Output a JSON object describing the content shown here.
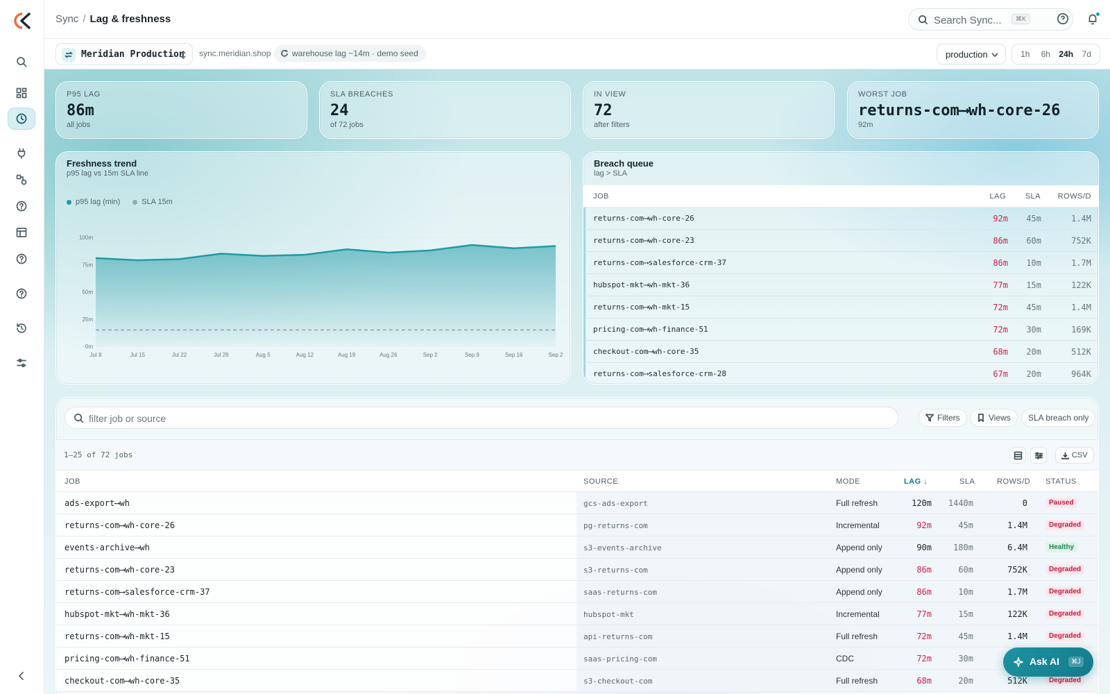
{
  "breadcrumb": {
    "root": "Sync",
    "separator": "/",
    "current": "Lag & freshness"
  },
  "search": {
    "placeholder": "Search Sync...",
    "shortcut": "⌘K"
  },
  "context": {
    "workspace": "Meridian Production",
    "domain": "sync.meridian.shop",
    "lag_note": "warehouse lag ~14m · demo seed",
    "environment": "production",
    "ranges": [
      "1h",
      "6h",
      "24h",
      "7d"
    ],
    "selected_range": "24h"
  },
  "stats": [
    {
      "label": "P95 LAG",
      "value": "86m",
      "sub": "all jobs"
    },
    {
      "label": "SLA BREACHES",
      "value": "24",
      "sub": "of 72 jobs"
    },
    {
      "label": "IN VIEW",
      "value": "72",
      "sub": "after filters"
    },
    {
      "label": "WORST JOB",
      "value": "returns-com⟶wh-core-26",
      "sub": "92m"
    }
  ],
  "trend": {
    "title": "Freshness trend",
    "subtitle": "p95 lag vs 15m SLA line"
  },
  "chart_data": {
    "type": "area",
    "title": "Freshness trend",
    "subtitle": "p95 lag vs 15m SLA line",
    "categories": [
      "Jul 8",
      "Jul 15",
      "Jul 22",
      "Jul 29",
      "Aug 5",
      "Aug 12",
      "Aug 19",
      "Aug 26",
      "Sep 2",
      "Sep 9",
      "Sep 16",
      "Sep 2"
    ],
    "series": [
      {
        "name": "p95 lag (min)",
        "values": [
          81,
          79,
          80,
          85,
          83,
          84,
          89,
          86,
          88,
          93,
          90,
          92
        ],
        "color": "#1f9aa6"
      },
      {
        "name": "SLA 15m",
        "values": [
          15,
          15,
          15,
          15,
          15,
          15,
          15,
          15,
          15,
          15,
          15,
          15
        ],
        "color": "#9aa7ad"
      }
    ],
    "yticks": [
      "0m",
      "25m",
      "50m",
      "75m",
      "100m"
    ],
    "ylim": [
      0,
      100
    ],
    "legend": "top-left",
    "grid": true
  },
  "breach_queue": {
    "title": "Breach queue",
    "subtitle": "lag > SLA",
    "columns": {
      "job": "JOB",
      "lag": "LAG",
      "sla": "SLA",
      "rows": "ROWS/D"
    },
    "rows": [
      {
        "job": "returns-com⟶wh-core-26",
        "lag": "92m",
        "sla": "45m",
        "rows": "1.4M"
      },
      {
        "job": "returns-com⟶wh-core-23",
        "lag": "86m",
        "sla": "60m",
        "rows": "752K"
      },
      {
        "job": "returns-com⟶salesforce-crm-37",
        "lag": "86m",
        "sla": "10m",
        "rows": "1.7M"
      },
      {
        "job": "hubspot-mkt⟶wh-mkt-36",
        "lag": "77m",
        "sla": "15m",
        "rows": "122K"
      },
      {
        "job": "returns-com⟶wh-mkt-15",
        "lag": "72m",
        "sla": "45m",
        "rows": "1.4M"
      },
      {
        "job": "pricing-com⟶wh-finance-51",
        "lag": "72m",
        "sla": "30m",
        "rows": "169K"
      },
      {
        "job": "checkout-com⟶wh-core-35",
        "lag": "68m",
        "sla": "20m",
        "rows": "512K"
      },
      {
        "job": "returns-com⟶salesforce-crm-28",
        "lag": "67m",
        "sla": "20m",
        "rows": "964K"
      }
    ]
  },
  "jobs": {
    "filter_placeholder": "filter job or source",
    "filters_label": "Filters",
    "views_label": "Views",
    "breach_only_label": "SLA breach only",
    "count_label": "1–25 of 72 jobs",
    "csv_label": "CSV",
    "columns": {
      "job": "JOB",
      "source": "SOURCE",
      "mode": "MODE",
      "lag": "LAG ↓",
      "sla": "SLA",
      "rows": "ROWS/D",
      "status": "STATUS"
    },
    "rows": [
      {
        "job": "ads-export⟶wh",
        "source": "gcs-ads-export",
        "mode": "Full refresh",
        "lag": "120m",
        "sla": "1440m",
        "rows": "0",
        "status": "Paused",
        "lag_color": "#17242a"
      },
      {
        "job": "returns-com⟶wh-core-26",
        "source": "pg-returns-com",
        "mode": "Incremental",
        "lag": "92m",
        "sla": "45m",
        "rows": "1.4M",
        "status": "Degraded",
        "lag_color": "#d1204a"
      },
      {
        "job": "events-archive⟶wh",
        "source": "s3-events-archive",
        "mode": "Append only",
        "lag": "90m",
        "sla": "180m",
        "rows": "6.4M",
        "status": "Healthy",
        "lag_color": "#17242a"
      },
      {
        "job": "returns-com⟶wh-core-23",
        "source": "s3-returns-com",
        "mode": "Append only",
        "lag": "86m",
        "sla": "60m",
        "rows": "752K",
        "status": "Degraded",
        "lag_color": "#d1204a"
      },
      {
        "job": "returns-com⟶salesforce-crm-37",
        "source": "saas-returns-com",
        "mode": "Append only",
        "lag": "86m",
        "sla": "10m",
        "rows": "1.7M",
        "status": "Degraded",
        "lag_color": "#d1204a"
      },
      {
        "job": "hubspot-mkt⟶wh-mkt-36",
        "source": "hubspot-mkt",
        "mode": "Incremental",
        "lag": "77m",
        "sla": "15m",
        "rows": "122K",
        "status": "Degraded",
        "lag_color": "#d1204a"
      },
      {
        "job": "returns-com⟶wh-mkt-15",
        "source": "api-returns-com",
        "mode": "Full refresh",
        "lag": "72m",
        "sla": "45m",
        "rows": "1.4M",
        "status": "Degraded",
        "lag_color": "#d1204a"
      },
      {
        "job": "pricing-com⟶wh-finance-51",
        "source": "saas-pricing-com",
        "mode": "CDC",
        "lag": "72m",
        "sla": "30m",
        "rows": "",
        "status": "",
        "lag_color": "#d1204a"
      },
      {
        "job": "checkout-com⟶wh-core-35",
        "source": "s3-checkout-com",
        "mode": "Full refresh",
        "lag": "68m",
        "sla": "20m",
        "rows": "512K",
        "status": "Degraded",
        "lag_color": "#d1204a"
      }
    ]
  },
  "ask_ai": {
    "label": "Ask AI",
    "shortcut": "⌘J"
  },
  "colors": {
    "accent": "#1f9aa6",
    "breach": "#d1204a",
    "healthy": "#1a8a4a"
  }
}
